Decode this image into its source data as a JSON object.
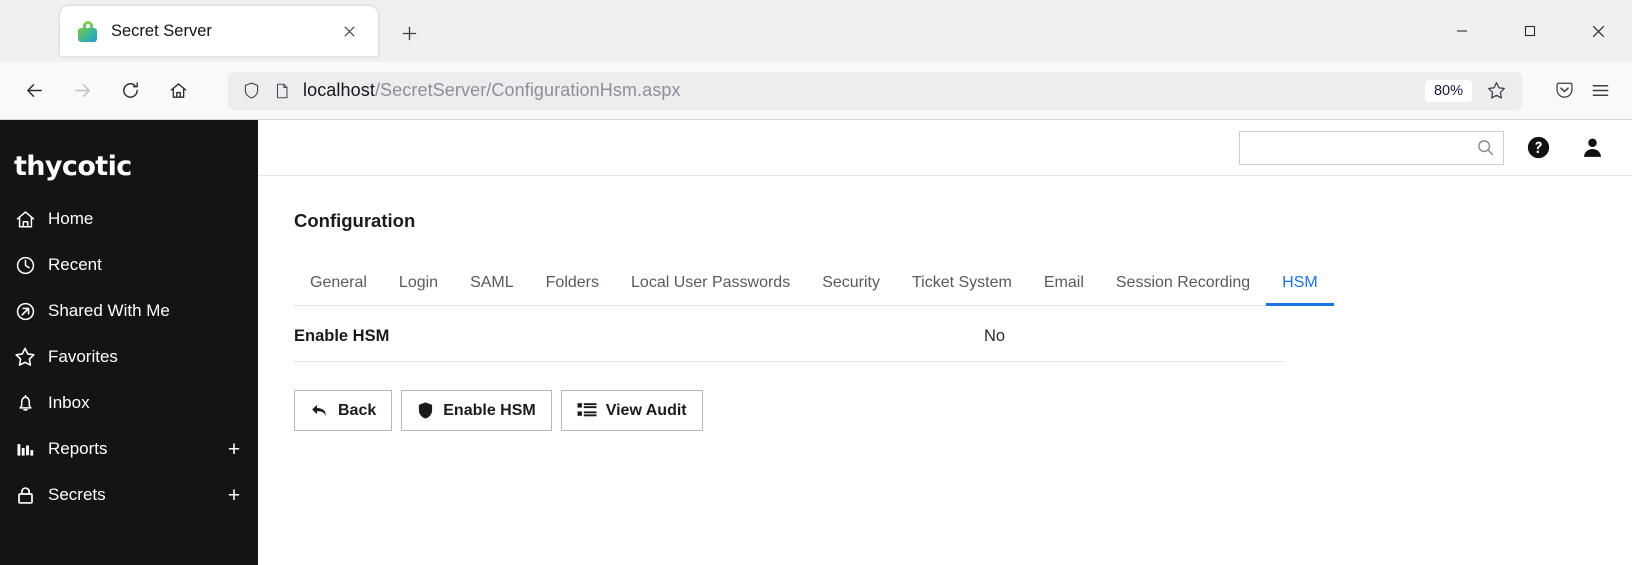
{
  "browser": {
    "tab": {
      "title": "Secret Server",
      "favicon": "padlock-icon",
      "close": "close-icon"
    },
    "new_tab": "new-tab-icon",
    "window_controls": {
      "minimize": "minimize-icon",
      "maximize": "maximize-icon",
      "close": "close-icon"
    },
    "nav": {
      "back": "back-arrow-icon",
      "forward": "forward-arrow-icon",
      "reload": "reload-icon",
      "home": "home-icon"
    },
    "url": {
      "host": "localhost",
      "path": "/SecretServer/ConfigurationHsm.aspx",
      "shield": "shield-icon",
      "page": "page-icon"
    },
    "zoom_level": "80%",
    "bookmark": "star-icon",
    "pocket": "pocket-icon",
    "menu": "hamburger-menu-icon"
  },
  "sidebar": {
    "logo": "thycotic",
    "items": [
      {
        "label": "Home",
        "icon": "home-icon",
        "expander": ""
      },
      {
        "label": "Recent",
        "icon": "clock-icon",
        "expander": ""
      },
      {
        "label": "Shared With Me",
        "icon": "share-arrow-icon",
        "expander": ""
      },
      {
        "label": "Favorites",
        "icon": "star-icon",
        "expander": ""
      },
      {
        "label": "Inbox",
        "icon": "bell-icon",
        "expander": ""
      },
      {
        "label": "Reports",
        "icon": "bar-chart-icon",
        "expander": "+"
      },
      {
        "label": "Secrets",
        "icon": "lock-icon",
        "expander": "+"
      }
    ]
  },
  "header": {
    "search": {
      "value": "",
      "placeholder": "",
      "icon": "search-icon"
    },
    "help": "help-icon",
    "user": "user-icon"
  },
  "main": {
    "title": "Configuration",
    "tabs": [
      {
        "label": "General",
        "active": false
      },
      {
        "label": "Login",
        "active": false
      },
      {
        "label": "SAML",
        "active": false
      },
      {
        "label": "Folders",
        "active": false
      },
      {
        "label": "Local User Passwords",
        "active": false
      },
      {
        "label": "Security",
        "active": false
      },
      {
        "label": "Ticket System",
        "active": false
      },
      {
        "label": "Email",
        "active": false
      },
      {
        "label": "Session Recording",
        "active": false
      },
      {
        "label": "HSM",
        "active": true
      }
    ],
    "fields": [
      {
        "label": "Enable HSM",
        "value": "No"
      }
    ],
    "buttons": [
      {
        "label": "Back",
        "icon": "back-arrow-icon"
      },
      {
        "label": "Enable HSM",
        "icon": "shield-icon"
      },
      {
        "label": "View Audit",
        "icon": "list-icon"
      }
    ]
  },
  "colors": {
    "accent": "#1a73e8",
    "sidebar_bg": "#141414",
    "chrome_bg": "#f0f0f0"
  }
}
